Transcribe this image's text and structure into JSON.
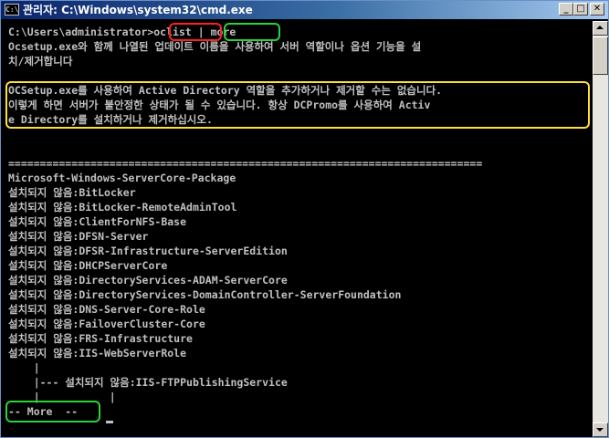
{
  "window": {
    "title": "관리자: C:\\Windows\\system32\\cmd.exe",
    "icon_label": "C:\\",
    "minimize_label": "_",
    "maximize_label": "□",
    "close_label": "✕"
  },
  "console": {
    "prompt": "C:\\Users\\administrator>",
    "command": "oclist",
    "pipe": " | ",
    "pipe_target": "more",
    "lines": [
      "Ocsetup.exe와 함께 나열된 업데이트 이름을 사용하여 서버 역할이나 옵션 기능을 설",
      "치/제거합니다",
      "",
      "OCSetup.exe를 사용하여 Active Directory 역할을 추가하거나 제거할 수는 없습니다.",
      "이렇게 하면 서버가 불안정한 상태가 될 수 있습니다. 항상 DCPromo를 사용하여 Activ",
      "e Directory를 설치하거나 제거하십시오.",
      "",
      "",
      "===========================================================================",
      "Microsoft-Windows-ServerCore-Package",
      "설치되지 않음:BitLocker",
      "설치되지 않음:BitLocker-RemoteAdminTool",
      "설치되지 않음:ClientForNFS-Base",
      "설치되지 않음:DFSN-Server",
      "설치되지 않음:DFSR-Infrastructure-ServerEdition",
      "설치되지 않음:DHCPServerCore",
      "설치되지 않음:DirectoryServices-ADAM-ServerCore",
      "설치되지 않음:DirectoryServices-DomainController-ServerFoundation",
      "설치되지 않음:DNS-Server-Core-Role",
      "설치되지 않음:FailoverCluster-Core",
      "설치되지 않음:FRS-Infrastructure",
      "설치되지 않음:IIS-WebServerRole",
      "    |",
      "    |--- 설치되지 않음:IIS-FTPPublishingService",
      "    |           |",
      "-- More  --"
    ]
  },
  "colors": {
    "annotation_red": "#ff2020",
    "annotation_green": "#2bd23a",
    "annotation_yellow": "#ffe033",
    "console_text": "#c0c0c0",
    "console_bg": "#000000"
  }
}
